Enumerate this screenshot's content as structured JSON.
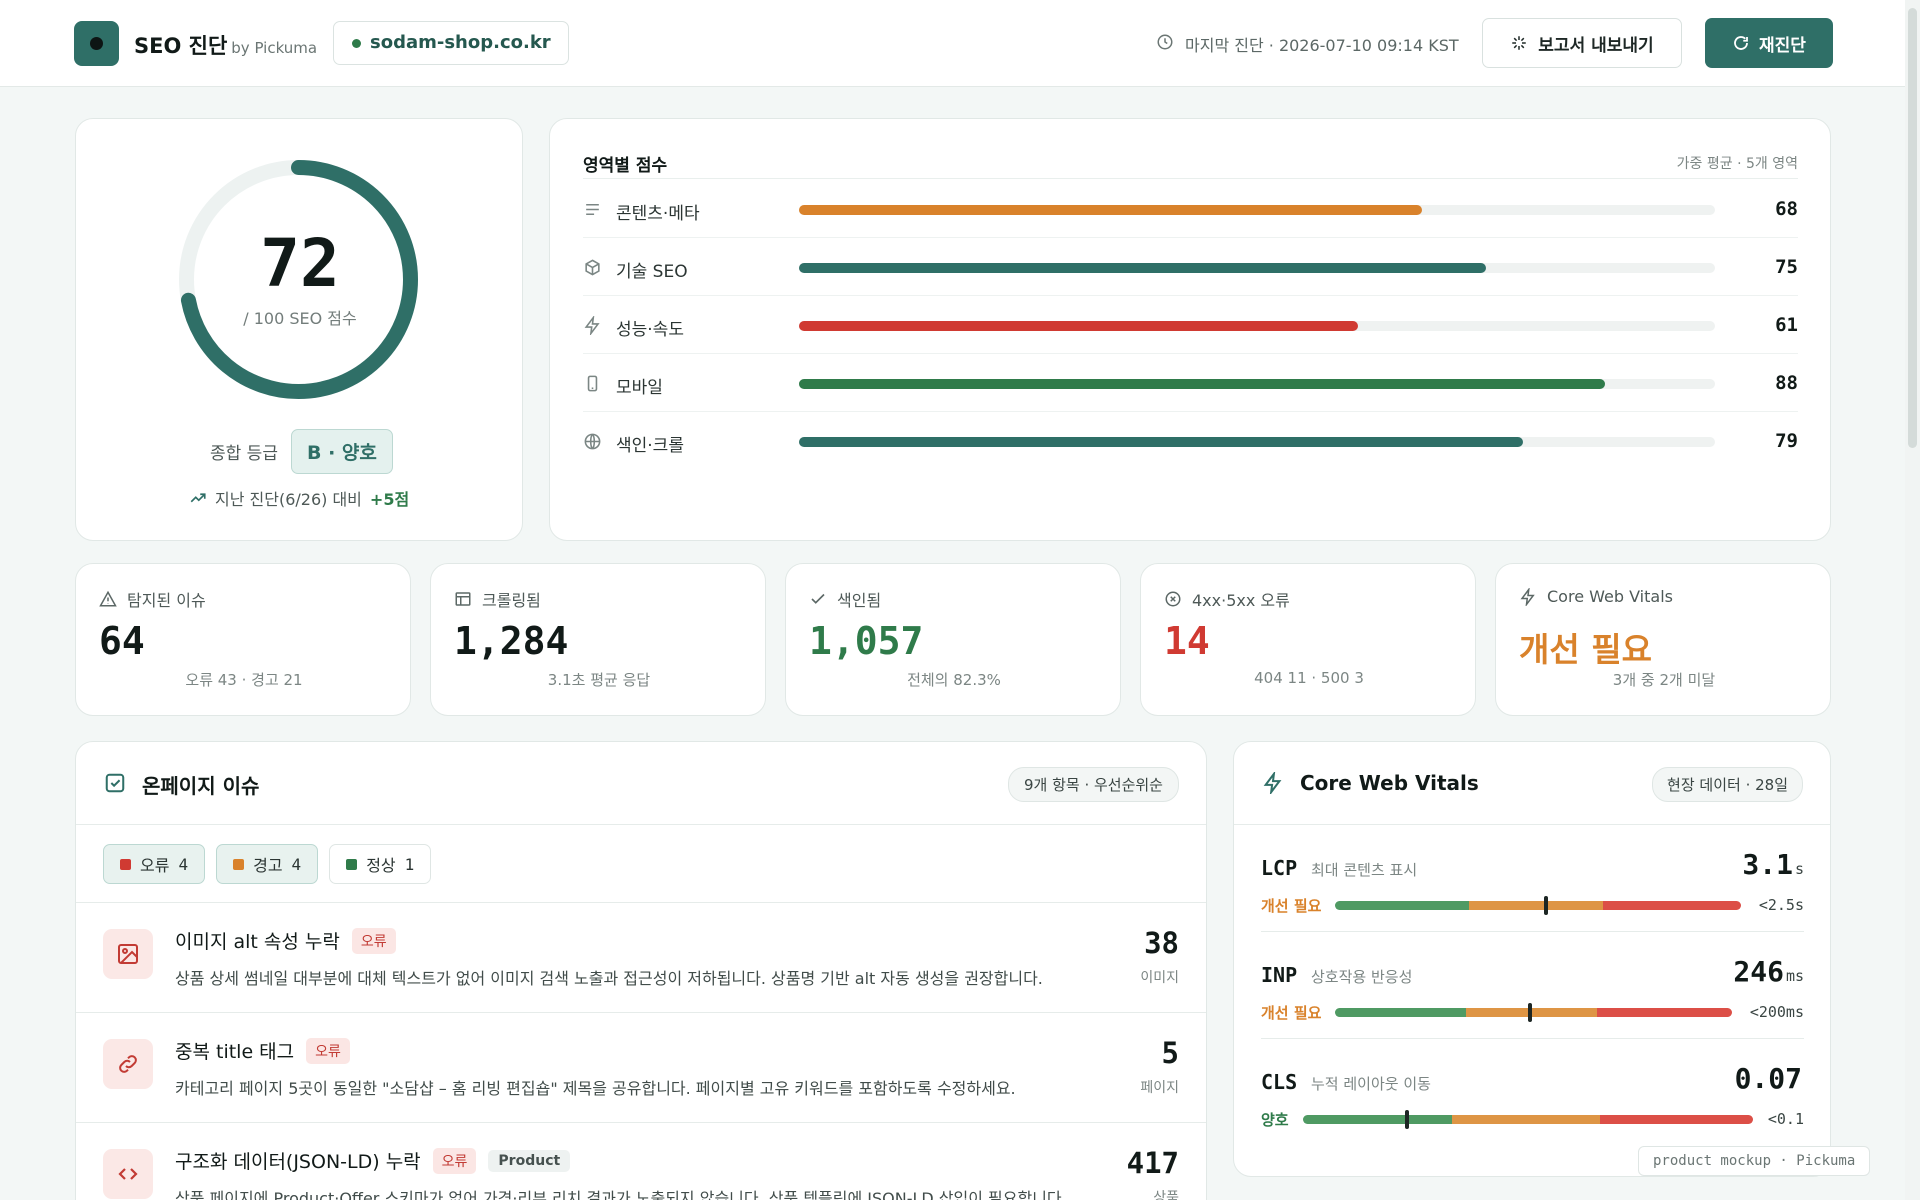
{
  "header": {
    "brand_title": "SEO 진단",
    "brand_by": "by Pickuma",
    "domain": "sodam-shop.co.kr",
    "last_check": "마지막 진단 · 2026-07-10 09:14 KST",
    "export_label": "보고서 내보내기",
    "rescan_label": "재진단"
  },
  "score": {
    "value": "72",
    "sub": "/ 100 SEO 점수",
    "grade_label": "종합 등급",
    "grade": "B · 양호",
    "trend_text": "지난 진단(6/26) 대비",
    "trend_delta": "+5점",
    "ring_fraction": 0.72,
    "ring_color": "#2f6f67"
  },
  "areas": {
    "title": "영역별 점수",
    "note": "가중 평균 · 5개 영역",
    "items": [
      {
        "icon": "lines-icon",
        "label": "콘텐츠·메타",
        "score": "68",
        "value": 68,
        "color": "#d9822b"
      },
      {
        "icon": "cube-icon",
        "label": "기술 SEO",
        "score": "75",
        "value": 75,
        "color": "#2f6f67"
      },
      {
        "icon": "bolt-icon",
        "label": "성능·속도",
        "score": "61",
        "value": 61,
        "color": "#d03a32"
      },
      {
        "icon": "mobile-icon",
        "label": "모바일",
        "score": "88",
        "value": 88,
        "color": "#2f7b4a"
      },
      {
        "icon": "globe-icon",
        "label": "색인·크롤",
        "score": "79",
        "value": 79,
        "color": "#2f6f67"
      }
    ]
  },
  "stats": [
    {
      "icon": "warning-icon",
      "label": "탐지된 이슈",
      "value": "64",
      "sub": "오류 43 · 경고 21",
      "color": "#111a18"
    },
    {
      "icon": "table-icon",
      "label": "크롤링됨",
      "value": "1,284",
      "sub": "3.1초 평균 응답",
      "color": "#111a18"
    },
    {
      "icon": "check-icon",
      "label": "색인됨",
      "value": "1,057",
      "sub": "전체의 82.3%",
      "color": "#2f7b4a"
    },
    {
      "icon": "x-circle-icon",
      "label": "4xx·5xx 오류",
      "value": "14",
      "sub": "404 11 · 500 3",
      "color": "#d03a32"
    },
    {
      "icon": "bolt-icon",
      "label": "Core Web Vitals",
      "value": "개선 필요",
      "sub": "3개 중 2개 미달",
      "color": "#d9822b"
    }
  ],
  "issues": {
    "title": "온페이지 이슈",
    "meta": "9개 항목 · 우선순위순",
    "filters": [
      {
        "label": "오류",
        "count": "4",
        "color": "#d03a32",
        "active": true
      },
      {
        "label": "경고",
        "count": "4",
        "color": "#d9822b",
        "active": true
      },
      {
        "label": "정상",
        "count": "1",
        "color": "#2f7b4a",
        "active": false
      }
    ],
    "items": [
      {
        "icon": "image-icon",
        "title": "이미지 alt 속성 누락",
        "tag": "오류",
        "extra_tag": "",
        "desc": "상품 상세 썸네일 대부분에 대체 텍스트가 없어 이미지 검색 노출과 접근성이 저하됩니다. 상품명 기반 alt 자동 생성을 권장합니다.",
        "count": "38",
        "unit": "이미지"
      },
      {
        "icon": "link-icon",
        "title": "중복 title 태그",
        "tag": "오류",
        "extra_tag": "",
        "desc": "카테고리 페이지 5곳이 동일한 \"소담샵 – 홈 리빙 편집숍\" 제목을 공유합니다. 페이지별 고유 키워드를 포함하도록 수정하세요.",
        "count": "5",
        "unit": "페이지"
      },
      {
        "icon": "code-icon",
        "title": "구조화 데이터(JSON-LD) 누락",
        "tag": "오류",
        "extra_tag": "Product",
        "desc": "상품 페이지에 Product·Offer 스키마가 없어 가격·리뷰 리치 결과가 노출되지 않습니다. 상품 템플릿에 JSON-LD 삽입이 필요합니다.",
        "count": "417",
        "unit": "상품"
      }
    ]
  },
  "cwv": {
    "title": "Core Web Vitals",
    "meta": "현장 데이터 · 28일",
    "metrics": [
      {
        "name": "LCP",
        "desc": "최대 콘텐츠 표시",
        "value": "3.1",
        "unit": "s",
        "status": "개선 필요",
        "status_color": "#d9822b",
        "target": "<2.5s",
        "marker_fraction": 0.52
      },
      {
        "name": "INP",
        "desc": "상호작용 반응성",
        "value": "246",
        "unit": "ms",
        "status": "개선 필요",
        "status_color": "#d9822b",
        "target": "<200ms",
        "marker_fraction": 0.49
      },
      {
        "name": "CLS",
        "desc": "누적 레이아웃 이동",
        "value": "0.07",
        "unit": "",
        "status": "양호",
        "status_color": "#2f7b4a",
        "target": "<0.1",
        "marker_fraction": 0.23
      }
    ]
  },
  "watermark": "product mockup · Pickuma"
}
